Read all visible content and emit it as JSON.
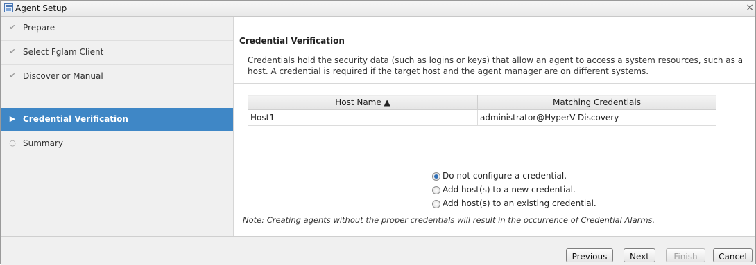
{
  "window": {
    "title": "Agent Setup",
    "close_glyph": "×"
  },
  "sidebar": {
    "steps": [
      {
        "label": "Prepare",
        "state": "done",
        "mark": "✔"
      },
      {
        "label": "Select Fglam Client",
        "state": "done",
        "mark": "✔"
      },
      {
        "label": "Discover or Manual",
        "state": "done",
        "mark": "✔"
      },
      {
        "label": "Credential Verification",
        "state": "active",
        "mark": "▶"
      },
      {
        "label": "Summary",
        "state": "pending",
        "mark": "○"
      }
    ]
  },
  "main": {
    "title": "Credential Verification",
    "description": "Credentials hold the security data (such as logins or keys) that allow an agent to access a system resources, such as a host. A credential is required if the target host and the agent manager are on different systems.",
    "table": {
      "columns": [
        "Host Name ▲",
        "Matching Credentials"
      ],
      "rows": [
        [
          "Host1",
          "administrator@HyperV-Discovery"
        ]
      ]
    },
    "options": [
      {
        "label": "Do not configure a credential.",
        "checked": true
      },
      {
        "label": "Add host(s) to a new credential.",
        "checked": false
      },
      {
        "label": "Add host(s) to an existing credential.",
        "checked": false
      }
    ],
    "note": "Note: Creating agents without the proper credentials will result in the occurrence of Credential Alarms."
  },
  "footer": {
    "previous": "Previous",
    "next": "Next",
    "finish": "Finish",
    "cancel": "Cancel"
  },
  "colors": {
    "active_step": "#3f87c6",
    "radio_dot": "#2f6fb6"
  }
}
